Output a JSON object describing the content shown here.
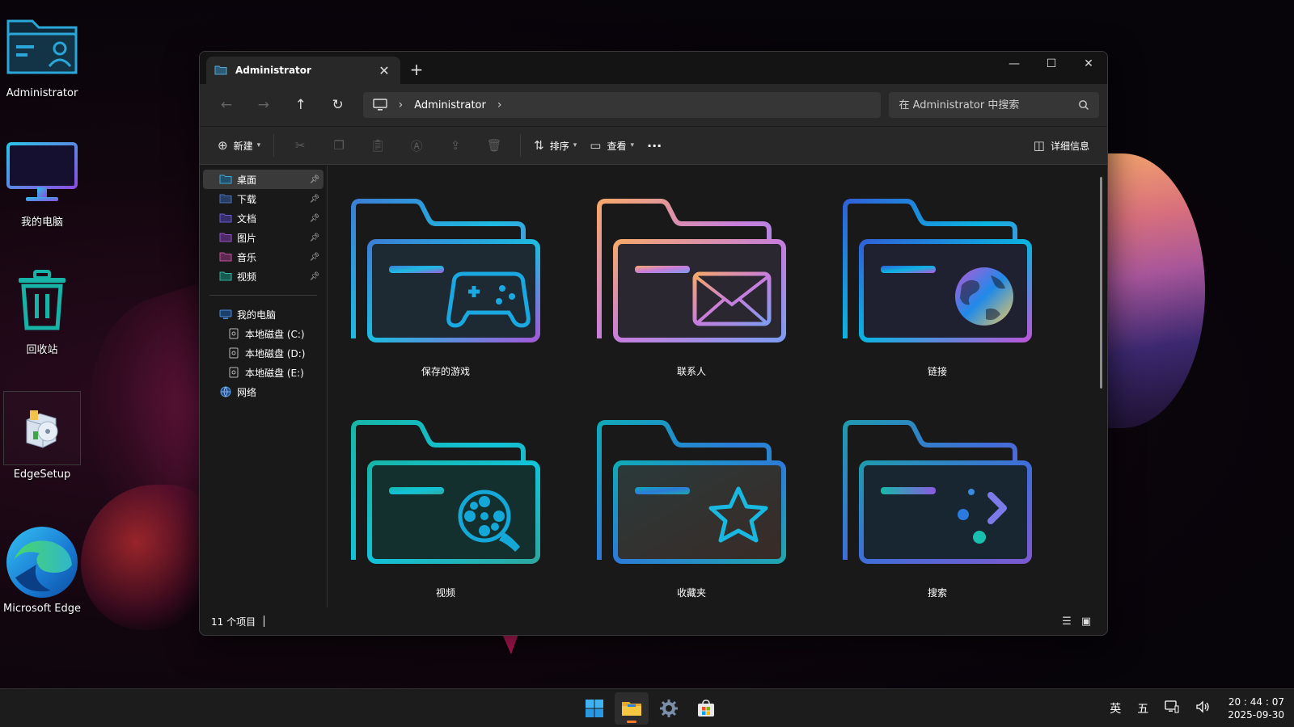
{
  "desktop": {
    "icons": [
      {
        "label": "Administrator"
      },
      {
        "label": "我的电脑"
      },
      {
        "label": "回收站"
      },
      {
        "label": "EdgeSetup"
      },
      {
        "label": "Microsoft Edge"
      }
    ]
  },
  "window": {
    "tab_title": "Administrator",
    "tab_close": "✕",
    "new_tab": "+",
    "controls": {
      "minimize": "—",
      "maximize": "☐",
      "close": "✕"
    },
    "nav": {
      "back": "←",
      "forward": "→",
      "up": "↑",
      "refresh": "↻"
    },
    "breadcrumb": [
      "Administrator"
    ],
    "search_placeholder": "在 Administrator 中搜索",
    "commands": {
      "new_label": "新建",
      "sort_label": "排序",
      "view_label": "查看",
      "more_label": "···",
      "details_label": "详细信息"
    },
    "sidebar": {
      "quick_access": [
        {
          "label": "桌面",
          "color": "#3aa7d8",
          "active": true
        },
        {
          "label": "下载",
          "color": "#4a72b8"
        },
        {
          "label": "文档",
          "color": "#6b5bd1"
        },
        {
          "label": "图片",
          "color": "#9a4fc9"
        },
        {
          "label": "音乐",
          "color": "#c24fa0"
        },
        {
          "label": "视频",
          "color": "#2fb3a0"
        }
      ],
      "this_pc": "我的电脑",
      "drives": [
        "本地磁盘 (C:)",
        "本地磁盘 (D:)",
        "本地磁盘 (E:)"
      ],
      "network": "网络"
    },
    "items": [
      {
        "label": "保存的游戏",
        "icon": "gamepad-icon",
        "colors": [
          "#3b7fd6",
          "#1dbbe0",
          "#a15ad8"
        ]
      },
      {
        "label": "联系人",
        "icon": "mail-icon",
        "colors": [
          "#f6a86b",
          "#c77ddc",
          "#7d9cf0"
        ]
      },
      {
        "label": "链接",
        "icon": "globe-icon",
        "colors": [
          "#2f62d8",
          "#0ab4e0",
          "#b957d8"
        ]
      },
      {
        "label": "视频",
        "icon": "film-reel-icon",
        "colors": [
          "#16b6a8",
          "#12c2d8",
          "#2ea8a0"
        ]
      },
      {
        "label": "收藏夹",
        "icon": "star-icon",
        "colors": [
          "#10a9b8",
          "#2c7bd8",
          "#1fa6b0"
        ]
      },
      {
        "label": "搜索",
        "icon": "search-results-icon",
        "colors": [
          "#1f9ab0",
          "#3f6ed8",
          "#7c5ad0"
        ]
      }
    ],
    "status": {
      "count": "11 个项目"
    }
  },
  "taskbar": {
    "ime_lang": "英",
    "ime_mode": "五",
    "time": "20 : 44 : 07",
    "date": "2025-09-30"
  }
}
